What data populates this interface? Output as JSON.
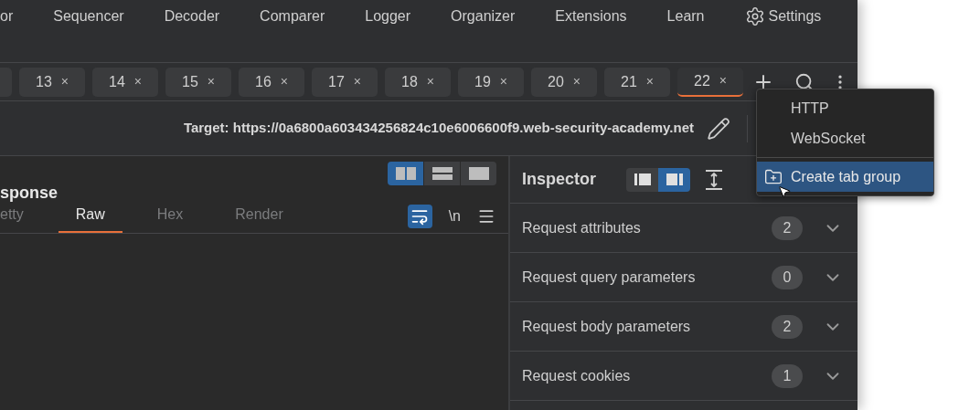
{
  "nav": [
    {
      "label": "or"
    },
    {
      "label": "Sequencer"
    },
    {
      "label": "Decoder"
    },
    {
      "label": "Comparer"
    },
    {
      "label": "Logger"
    },
    {
      "label": "Organizer"
    },
    {
      "label": "Extensions"
    },
    {
      "label": "Learn"
    },
    {
      "label": "Settings",
      "kind": "settings"
    }
  ],
  "tabs": [
    {
      "label": "13",
      "selected": false
    },
    {
      "label": "14",
      "selected": false
    },
    {
      "label": "15",
      "selected": false
    },
    {
      "label": "16",
      "selected": false
    },
    {
      "label": "17",
      "selected": false
    },
    {
      "label": "18",
      "selected": false
    },
    {
      "label": "19",
      "selected": false
    },
    {
      "label": "20",
      "selected": false
    },
    {
      "label": "21",
      "selected": false
    },
    {
      "label": "22",
      "selected": true
    }
  ],
  "close_glyph": "×",
  "target": "Target: https://0a6800a603434256824c10e6006600f9.web-security-academy.net",
  "response": {
    "title": "sponse",
    "layouts": [
      {
        "selected": true
      },
      {
        "selected": false
      },
      {
        "selected": false
      }
    ],
    "views": [
      {
        "label": "etty",
        "selected": false
      },
      {
        "label": "Raw",
        "selected": true
      },
      {
        "label": "Hex",
        "selected": false
      },
      {
        "label": "Render",
        "selected": false
      }
    ],
    "wrap_on": true,
    "newline_label": "\\n"
  },
  "inspector": {
    "title": "Inspector",
    "layouts": [
      {
        "selected": false
      },
      {
        "selected": true
      }
    ],
    "sections": [
      {
        "label": "Request attributes",
        "count": "2"
      },
      {
        "label": "Request query parameters",
        "count": "0"
      },
      {
        "label": "Request body parameters",
        "count": "2"
      },
      {
        "label": "Request cookies",
        "count": "1"
      }
    ]
  },
  "menu": [
    {
      "label": "HTTP",
      "selected": false,
      "kind": "plain"
    },
    {
      "label": "WebSocket",
      "selected": false,
      "kind": "plain"
    },
    {
      "label": "Create tab group",
      "selected": true,
      "kind": "group"
    }
  ]
}
